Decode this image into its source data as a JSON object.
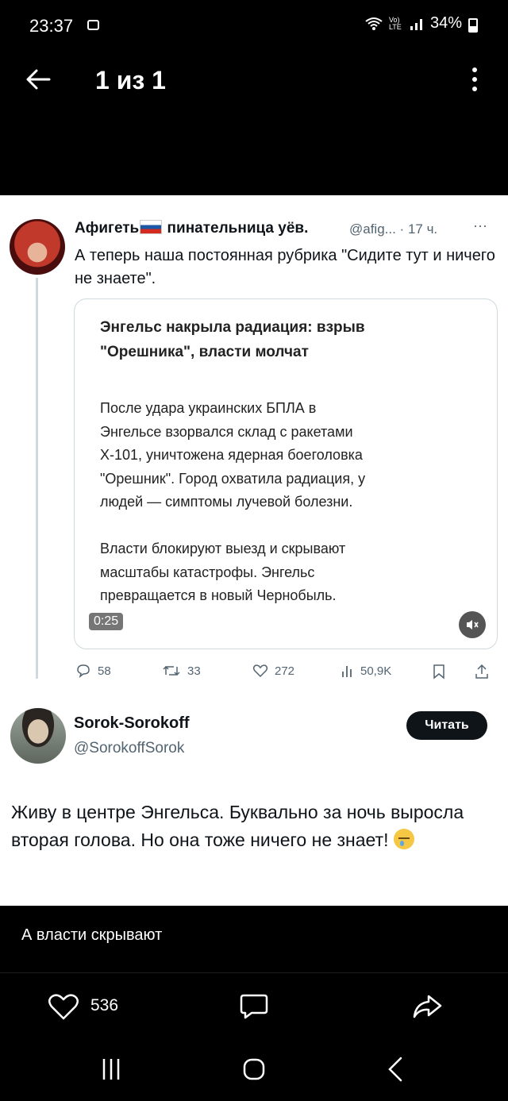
{
  "status_bar": {
    "time": "23:37",
    "signal_text": "Vo) LTE",
    "battery": "34%"
  },
  "viewer": {
    "title": "1 из 1"
  },
  "tweet1": {
    "name_part1": "Афигеть",
    "name_part2": "пинательница уёв.",
    "handle_time": "@afig... · 17 ч.",
    "more": "···",
    "text": "А теперь наша постоянная рубрика \"Сидите тут и ничего не знаете\".",
    "card": {
      "headline": "Энгельс накрыла радиация: взрыв \"Орешника\", власти молчат",
      "body": "После удара украинских БПЛА в\nЭнгельсе взорвался склад с ракетами\nХ-101, уничтожена ядерная боеголовка\n\"Орешник\". Город охватила радиация, у\nлюдей — симптомы лучевой болезни.\n\nВласти блокируют выезд и скрывают\nмасштабы катастрофы. Энгельс\nпревращается в новый Чернобыль.",
      "video_time": "0:25",
      "mute_icon": "speaker-muted-icon"
    },
    "actions": {
      "replies": "58",
      "retweets": "33",
      "likes": "272",
      "views": "50,9K"
    }
  },
  "tweet2": {
    "name": "Sorok-Sorokoff",
    "handle": "@SorokoffSorok",
    "follow_label": "Читать",
    "text": "Живу в центре Энгельса. Буквально за ночь выросла вторая голова. Но она тоже ничего не знает!"
  },
  "post": {
    "caption": "А власти скрывают",
    "like_count": "536"
  },
  "colors": {
    "background": "#000000",
    "card_bg": "#ffffff",
    "muted": "#536471"
  }
}
